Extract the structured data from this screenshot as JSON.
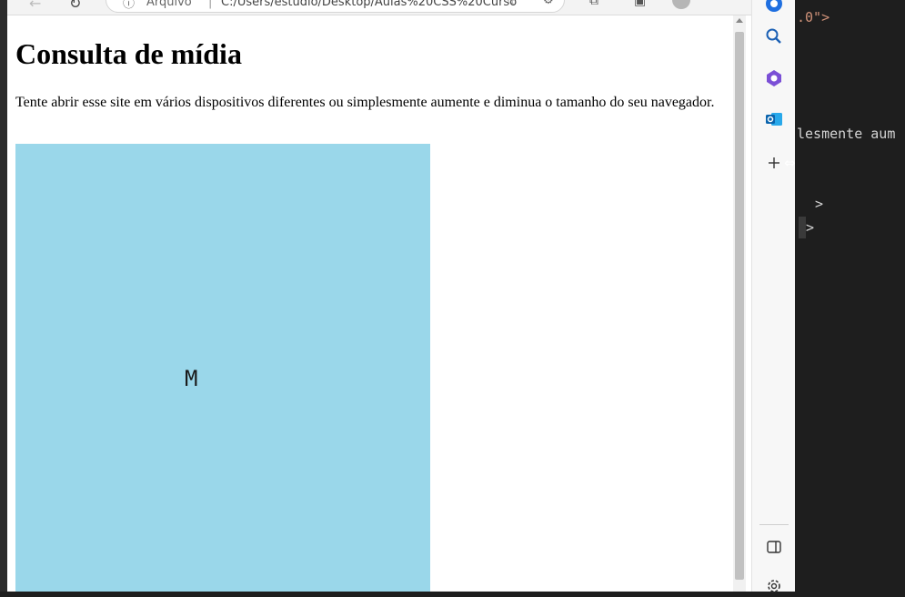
{
  "browser": {
    "address": {
      "protocol_label": "Arquivo",
      "url": "C:/Users/estudio/Desktop/Aulas%20CSS%20Curso"
    }
  },
  "page": {
    "heading": "Consulta de mídia",
    "paragraph": "Tente abrir esse site em vários dispositivos diferentes ou simplesmente aumente e diminua o tamanho do seu navegador.",
    "box": {
      "letter": "M",
      "background": "#9ad7ea"
    }
  },
  "sidebar": {
    "items": [
      {
        "icon": "copilot-icon"
      },
      {
        "icon": "search-icon"
      },
      {
        "icon": "office-icon"
      },
      {
        "icon": "outlook-icon"
      },
      {
        "icon": "add-icon"
      },
      {
        "icon": "sidebar-toggle-icon"
      },
      {
        "icon": "settings-icon"
      }
    ]
  },
  "code_panel": {
    "lines": [
      ".0\">",
      "lesmente aum",
      ">",
      ">"
    ],
    "color_text": "#d4d4d4",
    "color_string": "#ce9178"
  }
}
